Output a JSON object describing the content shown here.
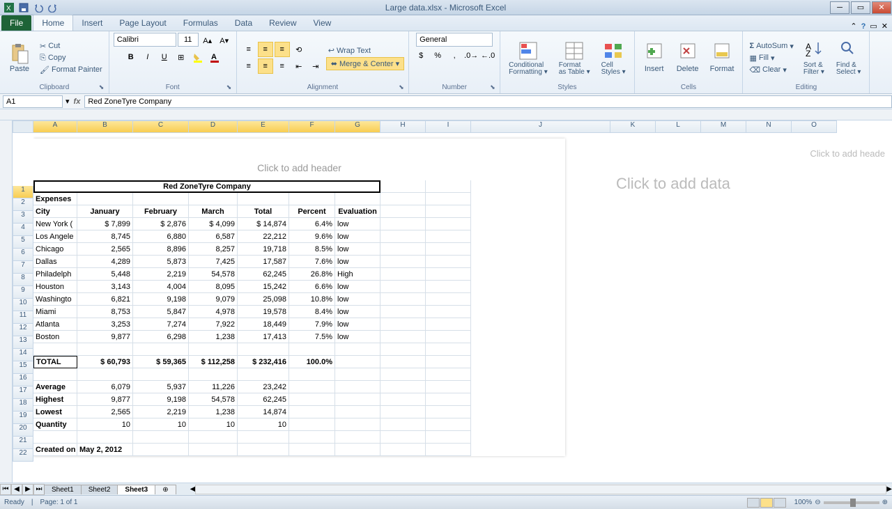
{
  "app": {
    "title": "Large data.xlsx - Microsoft Excel"
  },
  "tabs": {
    "file": "File",
    "home": "Home",
    "insert": "Insert",
    "pageLayout": "Page Layout",
    "formulas": "Formulas",
    "data": "Data",
    "review": "Review",
    "view": "View"
  },
  "clipboard": {
    "paste": "Paste",
    "cut": "Cut",
    "copy": "Copy",
    "painter": "Format Painter",
    "label": "Clipboard"
  },
  "font": {
    "name": "Calibri",
    "size": "11",
    "label": "Font"
  },
  "alignment": {
    "wrap": "Wrap Text",
    "merge": "Merge & Center",
    "label": "Alignment"
  },
  "number": {
    "format": "General",
    "label": "Number"
  },
  "styles": {
    "cond": "Conditional Formatting",
    "table": "Format as Table",
    "cell": "Cell Styles",
    "label": "Styles"
  },
  "cells": {
    "insert": "Insert",
    "delete": "Delete",
    "format": "Format",
    "label": "Cells"
  },
  "editing": {
    "autosum": "AutoSum",
    "fill": "Fill",
    "clear": "Clear",
    "sort": "Sort & Filter",
    "find": "Find & Select",
    "label": "Editing"
  },
  "namebox": "A1",
  "formula": "Red ZoneTyre Company",
  "cols": [
    "A",
    "B",
    "C",
    "D",
    "E",
    "F",
    "G",
    "H",
    "I",
    "J",
    "K",
    "L",
    "M",
    "N",
    "O"
  ],
  "colWidths": {
    "A": 63,
    "B": 80,
    "C": 80,
    "D": 70,
    "E": 74,
    "F": 66,
    "G": 65,
    "H": 65,
    "I": 65
  },
  "pageHeader": "Click to add header",
  "sideHeader": "Click to add heade",
  "sideData": "Click to add data",
  "sheet": {
    "title": "Red ZoneTyre Company",
    "expenses": "Expenses",
    "headers": [
      "City",
      "January",
      "February",
      "March",
      "Total",
      "Percent",
      "Evaluation"
    ],
    "rows": [
      {
        "city": "New York (",
        "jan": "$       7,899",
        "feb": "$     2,876",
        "mar": "$      4,099",
        "tot": "$    14,874",
        "pct": "6.4%",
        "eval": "low"
      },
      {
        "city": "Los Angele",
        "jan": "8,745",
        "feb": "6,880",
        "mar": "6,587",
        "tot": "22,212",
        "pct": "9.6%",
        "eval": "low"
      },
      {
        "city": "Chicago",
        "jan": "2,565",
        "feb": "8,896",
        "mar": "8,257",
        "tot": "19,718",
        "pct": "8.5%",
        "eval": "low"
      },
      {
        "city": "Dallas",
        "jan": "4,289",
        "feb": "5,873",
        "mar": "7,425",
        "tot": "17,587",
        "pct": "7.6%",
        "eval": "low"
      },
      {
        "city": "Philadelph",
        "jan": "5,448",
        "feb": "2,219",
        "mar": "54,578",
        "tot": "62,245",
        "pct": "26.8%",
        "eval": "High"
      },
      {
        "city": "Houston",
        "jan": "3,143",
        "feb": "4,004",
        "mar": "8,095",
        "tot": "15,242",
        "pct": "6.6%",
        "eval": "low"
      },
      {
        "city": "Washingto",
        "jan": "6,821",
        "feb": "9,198",
        "mar": "9,079",
        "tot": "25,098",
        "pct": "10.8%",
        "eval": "low"
      },
      {
        "city": "Miami",
        "jan": "8,753",
        "feb": "5,847",
        "mar": "4,978",
        "tot": "19,578",
        "pct": "8.4%",
        "eval": "low"
      },
      {
        "city": "Atlanta",
        "jan": "3,253",
        "feb": "7,274",
        "mar": "7,922",
        "tot": "18,449",
        "pct": "7.9%",
        "eval": "low"
      },
      {
        "city": "Boston",
        "jan": "9,877",
        "feb": "6,298",
        "mar": "1,238",
        "tot": "17,413",
        "pct": "7.5%",
        "eval": "low"
      }
    ],
    "total": {
      "label": "TOTAL",
      "jan": "$    60,793",
      "feb": "$   59,365",
      "mar": "$  112,258",
      "tot": "$  232,416",
      "pct": "100.0%"
    },
    "stats": [
      {
        "label": "Average",
        "jan": "6,079",
        "feb": "5,937",
        "mar": "11,226",
        "tot": "23,242"
      },
      {
        "label": "Highest",
        "jan": "9,877",
        "feb": "9,198",
        "mar": "54,578",
        "tot": "62,245"
      },
      {
        "label": "Lowest",
        "jan": "2,565",
        "feb": "2,219",
        "mar": "1,238",
        "tot": "14,874"
      },
      {
        "label": "Quantity",
        "jan": "10",
        "feb": "10",
        "mar": "10",
        "tot": "10"
      }
    ],
    "created": {
      "label": "Created on",
      "date": "May 2, 2012"
    }
  },
  "sheetTabs": [
    "Sheet1",
    "Sheet2",
    "Sheet3"
  ],
  "status": {
    "ready": "Ready",
    "page": "Page: 1 of 1",
    "zoom": "100%"
  }
}
